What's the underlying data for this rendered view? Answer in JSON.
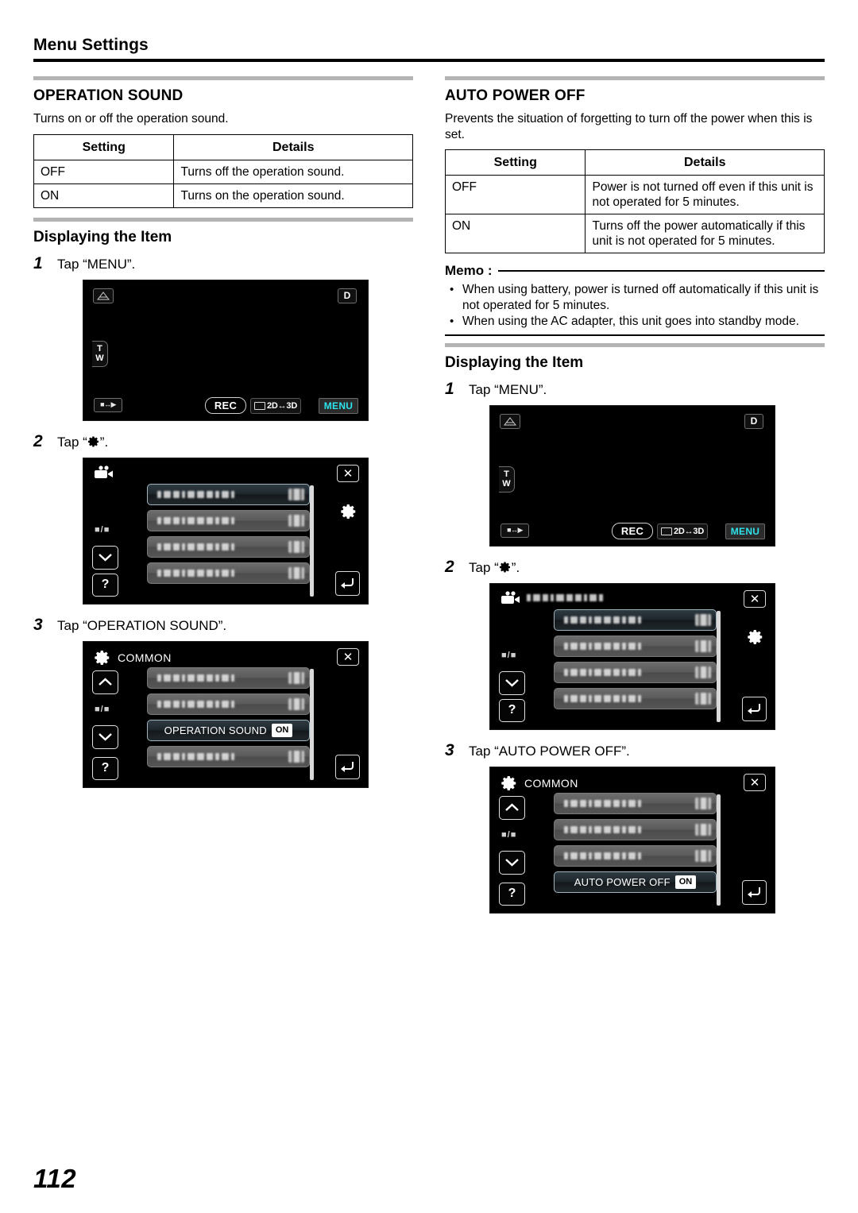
{
  "header": {
    "title": "Menu Settings"
  },
  "page": {
    "folio": "112"
  },
  "left": {
    "section_title": "OPERATION SOUND",
    "lead": "Turns on or off the operation sound.",
    "table": {
      "headers": [
        "Setting",
        "Details"
      ],
      "rows": [
        [
          "OFF",
          "Turns off the operation sound."
        ],
        [
          "ON",
          "Turns on the operation sound."
        ]
      ]
    },
    "sub_title": "Displaying the Item",
    "steps": [
      {
        "num": "1",
        "text": "Tap “MENU”."
      },
      {
        "num": "2",
        "text_before": "Tap “",
        "text_after": "”.",
        "icon": "gear-icon"
      },
      {
        "num": "3",
        "text": "Tap “OPERATION SOUND”."
      }
    ],
    "screen_rec": {
      "name": "recording-screen",
      "icons": {
        "warning": "tripod-icon",
        "d_badge": "D",
        "zoom_t": "T",
        "zoom_w": "W",
        "playback": "record-play-toggle-icon",
        "rec": "REC",
        "dim_2d3d": "2D↔3D",
        "menu": "MENU"
      }
    },
    "screen_menu": {
      "name": "recording-menu-screen",
      "title_icon": "video-camera-icon",
      "page_indicator": "■/■",
      "help": "?",
      "rows": 4,
      "selected_row": 1
    },
    "screen_common": {
      "name": "common-menu-screen",
      "title_icon": "gear-icon",
      "title": "COMMON",
      "page_indicator": "■/■",
      "help": "?",
      "rows": 4,
      "selected_row": 3,
      "selected_label": "OPERATION SOUND",
      "selected_value": "ON"
    }
  },
  "right": {
    "section_title": "AUTO POWER OFF",
    "lead": "Prevents the situation of forgetting to turn off the power when this is set.",
    "table": {
      "headers": [
        "Setting",
        "Details"
      ],
      "rows": [
        [
          "OFF",
          "Power is not turned off even if this unit is not operated for 5 minutes."
        ],
        [
          "ON",
          "Turns off the power automatically if this unit is not operated for 5 minutes."
        ]
      ]
    },
    "memo": {
      "label": "Memo :",
      "items": [
        "When using battery, power is turned off automatically if this unit is not operated for 5 minutes.",
        "When using the AC adapter, this unit goes into standby mode."
      ]
    },
    "sub_title": "Displaying the Item",
    "steps": [
      {
        "num": "1",
        "text": "Tap “MENU”."
      },
      {
        "num": "2",
        "text_before": "Tap “",
        "text_after": "”.",
        "icon": "gear-icon"
      },
      {
        "num": "3",
        "text": "Tap “AUTO POWER OFF”."
      }
    ],
    "screen_rec": {
      "name": "recording-screen",
      "icons": {
        "warning": "tripod-icon",
        "d_badge": "D",
        "zoom_t": "T",
        "zoom_w": "W",
        "playback": "record-play-toggle-icon",
        "rec": "REC",
        "dim_2d3d": "2D↔3D",
        "menu": "MENU"
      }
    },
    "screen_menu": {
      "name": "recording-menu-screen",
      "title_icon": "video-camera-icon",
      "page_indicator": "■/■",
      "help": "?",
      "rows": 4,
      "selected_row": 1
    },
    "screen_common": {
      "name": "common-menu-screen",
      "title_icon": "gear-icon",
      "title": "COMMON",
      "page_indicator": "■/■",
      "help": "?",
      "rows": 4,
      "selected_row": 4,
      "selected_label": "AUTO POWER OFF",
      "selected_value": "ON"
    }
  },
  "colors": {
    "menu_accent": "#2ee3ec",
    "rule": "#000000",
    "graybar": "#b3b3b3"
  }
}
